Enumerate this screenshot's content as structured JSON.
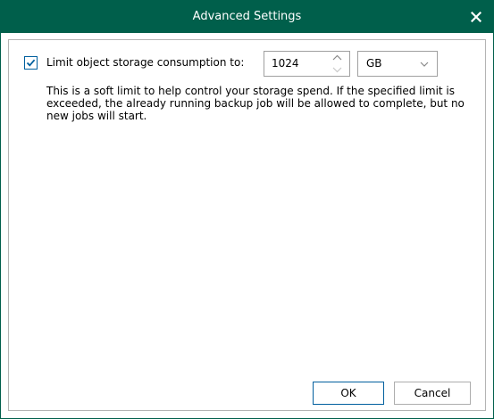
{
  "window": {
    "title": "Advanced Settings"
  },
  "limit": {
    "checked": true,
    "label": "Limit object storage consumption to:",
    "value": "1024",
    "unit": "GB",
    "description": "This is a soft limit to help control your storage spend. If the specified limit is exceeded, the already running backup job will be allowed to complete, but no new jobs will start."
  },
  "buttons": {
    "ok": "OK",
    "cancel": "Cancel"
  },
  "icons": {
    "close": "close-icon",
    "check": "checkmark-icon",
    "spin_up": "chevron-up-icon",
    "spin_down": "chevron-down-icon",
    "dropdown": "chevron-down-icon"
  },
  "colors": {
    "titlebar": "#005f4b",
    "accent": "#005f9e",
    "border": "#a0a0a0"
  }
}
